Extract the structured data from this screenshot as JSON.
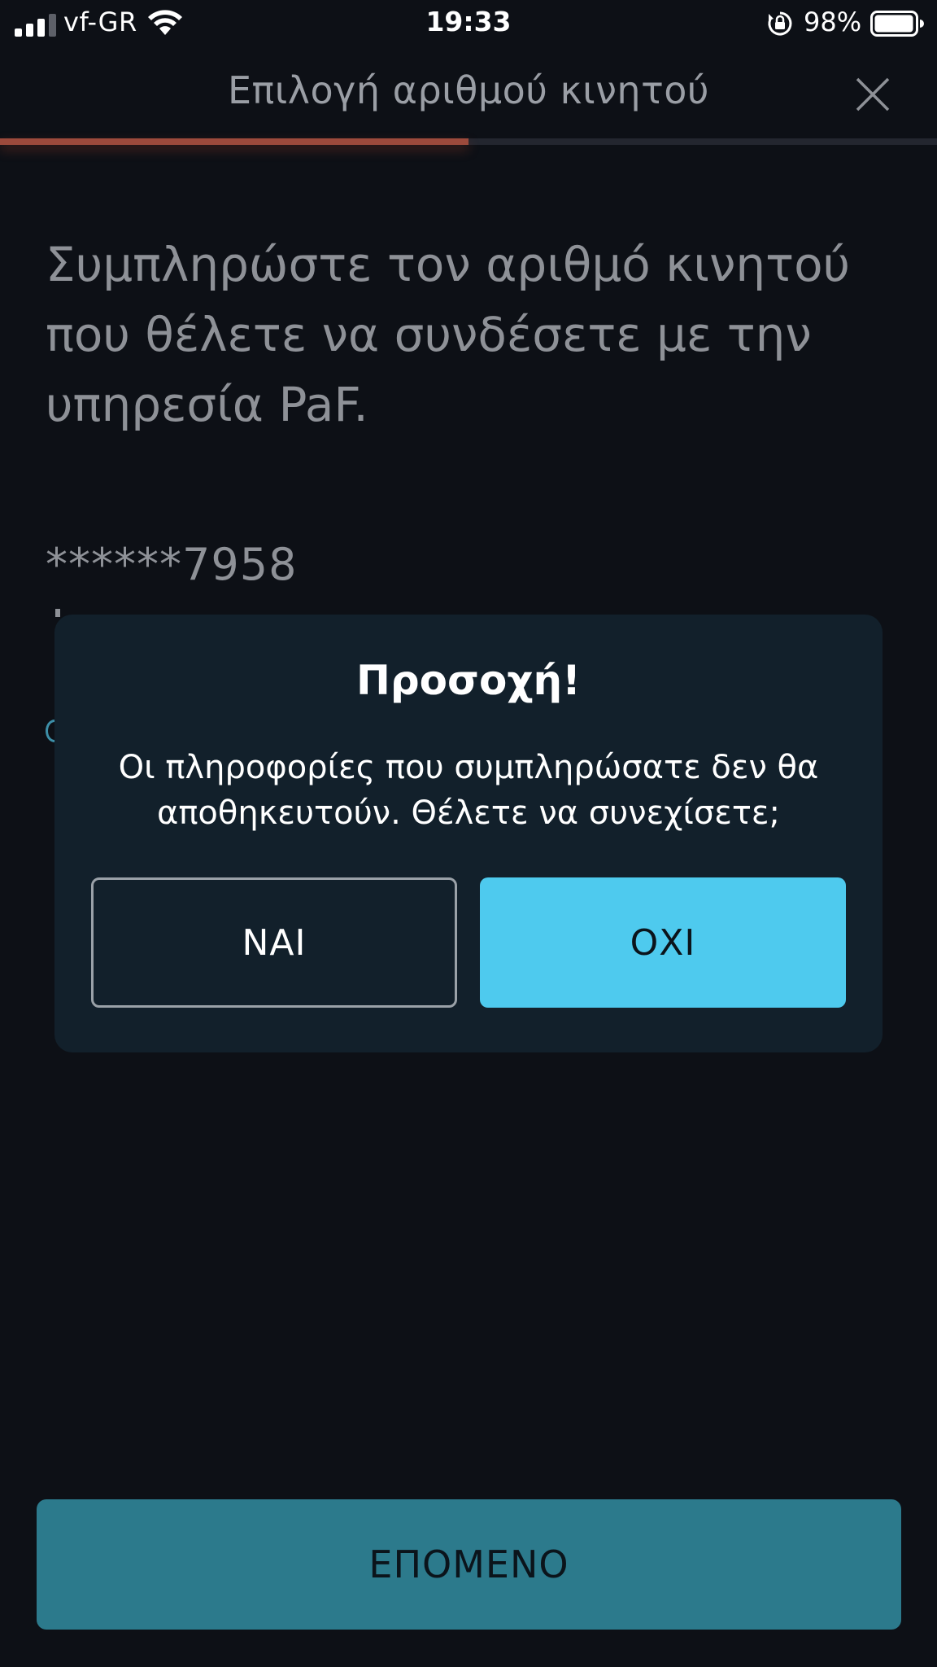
{
  "status_bar": {
    "carrier": "vf-GR",
    "time": "19:33",
    "battery_percent": "98%",
    "battery_level": 0.98,
    "signal_icon": "cellular-signal-icon",
    "wifi_icon": "wifi-icon",
    "rotation_lock_icon": "rotation-lock-icon",
    "battery_icon": "battery-icon"
  },
  "nav": {
    "title": "Επιλογή αριθμού κινητού",
    "close_icon": "close-icon",
    "progress": 0.5,
    "progress_color": "#9c4a3c"
  },
  "content": {
    "instruction": "Συμπληρώστε τον αριθμό κινητού που θέλετε να συνδέσετε με την υπηρεσία PaF.",
    "phone_number": "******7958"
  },
  "dialog": {
    "title": "Προσοχή!",
    "message": "Οι πληροφορίες που συμπληρώσατε δεν θα αποθηκευτούν. Θέλετε να συνεχίσετε;",
    "yes_label": "ΝΑΙ",
    "no_label": "ΟΧΙ",
    "accent_color": "#4ecaee"
  },
  "footer": {
    "next_label": "ΕΠΟΜΕΝΟ",
    "button_color": "#2c7a8c"
  }
}
